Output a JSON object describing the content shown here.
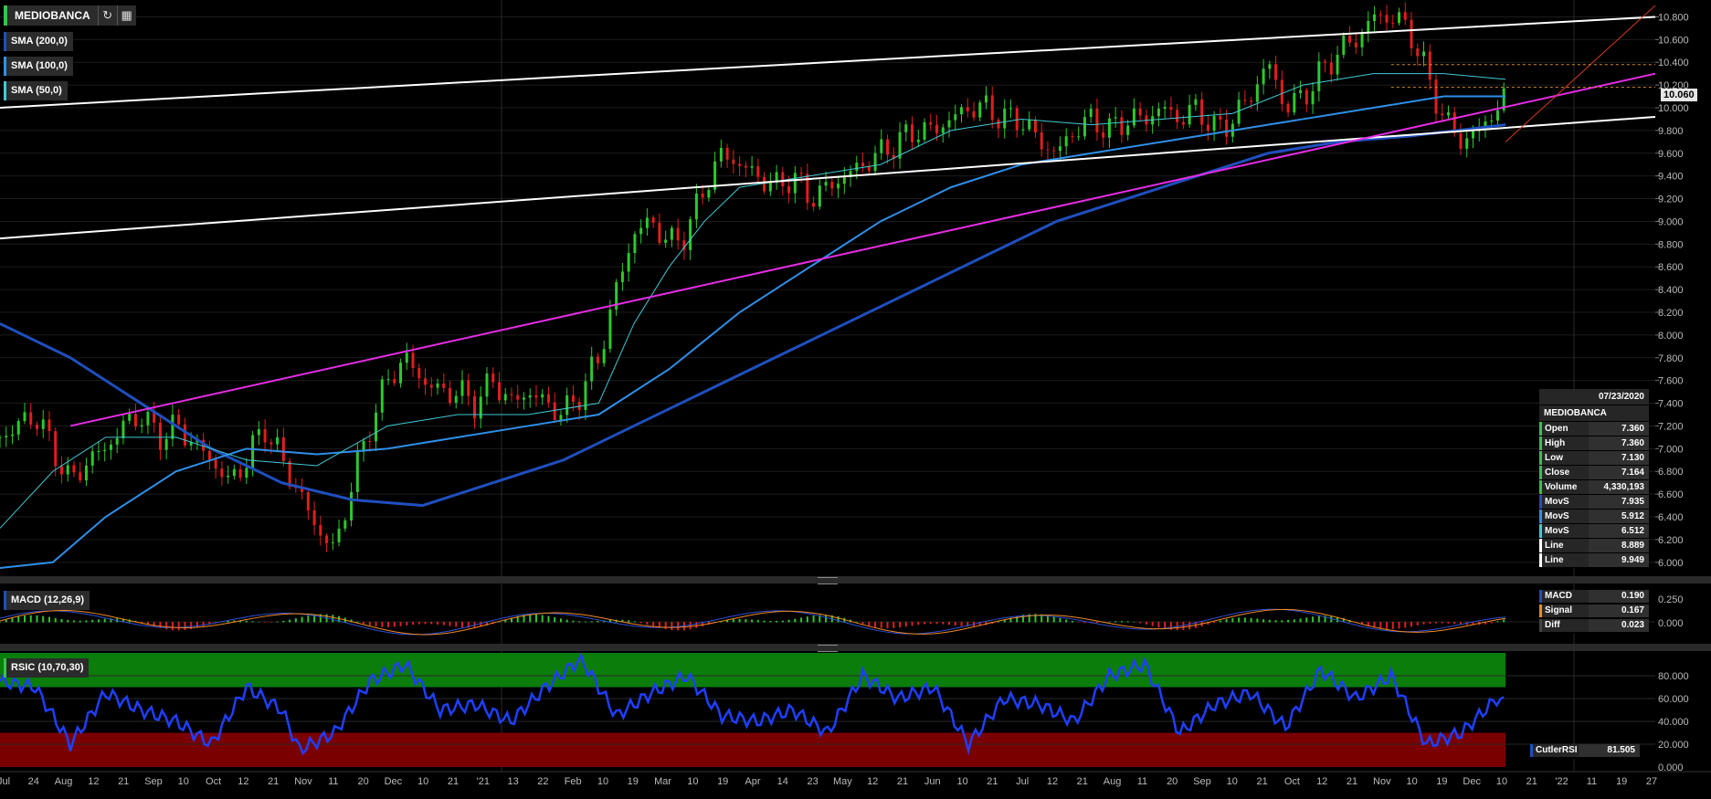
{
  "header": {
    "symbol": "MEDIOBANCA",
    "refresh_icon": "refresh-icon",
    "settings_icon": "chart-settings-icon"
  },
  "indicators": [
    {
      "label": "SMA (200,0)",
      "color": "#1f4fbf"
    },
    {
      "label": "SMA (100,0)",
      "color": "#2f8fe8"
    },
    {
      "label": "SMA (50,0)",
      "color": "#41c9d6"
    }
  ],
  "info_panel": {
    "date": "07/23/2020",
    "symbol": "MEDIOBANCA",
    "rows": [
      {
        "k": "Open",
        "v": "7.360",
        "c": "#39c24a"
      },
      {
        "k": "High",
        "v": "7.360",
        "c": "#39c24a"
      },
      {
        "k": "Low",
        "v": "7.130",
        "c": "#39c24a"
      },
      {
        "k": "Close",
        "v": "7.164",
        "c": "#39c24a"
      },
      {
        "k": "Volume",
        "v": "4,330,193",
        "c": "#39c24a"
      },
      {
        "k": "MovS",
        "v": "7.935",
        "c": "#1f4fbf"
      },
      {
        "k": "MovS",
        "v": "5.912",
        "c": "#2f8fe8"
      },
      {
        "k": "MovS",
        "v": "6.512",
        "c": "#41c9d6"
      },
      {
        "k": "Line",
        "v": "8.889",
        "c": "#ffffff"
      },
      {
        "k": "Line",
        "v": "9.949",
        "c": "#ffffff"
      }
    ]
  },
  "macd": {
    "label": "MACD (12,26,9)",
    "rows": [
      {
        "k": "MACD",
        "v": "0.190",
        "c": "#1f4fbf"
      },
      {
        "k": "Signal",
        "v": "0.167",
        "c": "#f08a24"
      },
      {
        "k": "Diff",
        "v": "0.023",
        "c": "#444444"
      }
    ],
    "ticks": [
      "0.250",
      "0.000"
    ]
  },
  "rsi": {
    "label": "RSIC (10,70,30)",
    "rows": [
      {
        "k": "CutlerRSI",
        "v": "81.505",
        "c": "#1f4fbf"
      }
    ],
    "ticks": [
      "80.000",
      "60.000",
      "40.000",
      "20.000",
      "0.000"
    ]
  },
  "current_price": "10.060",
  "chart_data": {
    "type": "candlestick",
    "symbol": "MEDIOBANCA",
    "y_ticks": [
      "10.800",
      "10.600",
      "10.400",
      "10.200",
      "10.000",
      "9.800",
      "9.600",
      "9.400",
      "9.200",
      "9.000",
      "8.800",
      "8.600",
      "8.400",
      "8.200",
      "8.000",
      "7.800",
      "7.600",
      "7.400",
      "7.200",
      "7.000",
      "6.800",
      "6.600",
      "6.400",
      "6.200",
      "6.000"
    ],
    "ylim": [
      5.95,
      10.9
    ],
    "x_tick_labels": [
      "Jul",
      "24",
      "Aug",
      "12",
      "21",
      "Sep",
      "10",
      "Oct",
      "12",
      "21",
      "Nov",
      "11",
      "20",
      "Dec",
      "10",
      "21",
      "'21",
      "13",
      "22",
      "Feb",
      "10",
      "19",
      "Mar",
      "10",
      "19",
      "Apr",
      "14",
      "23",
      "May",
      "12",
      "21",
      "Jun",
      "10",
      "21",
      "Jul",
      "12",
      "21",
      "Aug",
      "11",
      "20",
      "Sep",
      "10",
      "21",
      "Oct",
      "12",
      "21",
      "Nov",
      "10",
      "19",
      "Dec",
      "10",
      "21",
      "'22",
      "11",
      "19",
      "27"
    ],
    "approx_close_path": [
      [
        0,
        7.1
      ],
      [
        10,
        7.2
      ],
      [
        20,
        7.3
      ],
      [
        30,
        7.0
      ],
      [
        40,
        6.7
      ],
      [
        50,
        6.9
      ],
      [
        60,
        7.0
      ],
      [
        70,
        7.2
      ],
      [
        80,
        7.3
      ],
      [
        90,
        7.1
      ],
      [
        100,
        7.2
      ],
      [
        110,
        7.05
      ],
      [
        120,
        6.9
      ],
      [
        130,
        6.7
      ],
      [
        140,
        6.9
      ],
      [
        150,
        7.2
      ],
      [
        160,
        6.9
      ],
      [
        170,
        6.6
      ],
      [
        180,
        6.3
      ],
      [
        190,
        6.1
      ],
      [
        200,
        6.7
      ],
      [
        210,
        7.2
      ],
      [
        220,
        7.6
      ],
      [
        230,
        7.8
      ],
      [
        240,
        7.6
      ],
      [
        250,
        7.5
      ],
      [
        260,
        7.5
      ],
      [
        270,
        7.4
      ],
      [
        280,
        7.6
      ],
      [
        290,
        7.4
      ],
      [
        300,
        7.5
      ],
      [
        310,
        7.4
      ],
      [
        320,
        7.3
      ],
      [
        330,
        7.5
      ],
      [
        340,
        7.8
      ],
      [
        350,
        8.4
      ],
      [
        360,
        8.9
      ],
      [
        370,
        9.0
      ],
      [
        380,
        8.8
      ],
      [
        390,
        8.9
      ],
      [
        400,
        9.3
      ],
      [
        410,
        9.6
      ],
      [
        420,
        9.5
      ],
      [
        430,
        9.4
      ],
      [
        440,
        9.3
      ],
      [
        450,
        9.4
      ],
      [
        460,
        9.2
      ],
      [
        470,
        9.3
      ],
      [
        480,
        9.4
      ],
      [
        490,
        9.5
      ],
      [
        500,
        9.6
      ],
      [
        510,
        9.7
      ],
      [
        520,
        9.8
      ],
      [
        530,
        9.8
      ],
      [
        540,
        9.9
      ],
      [
        550,
        10.0
      ],
      [
        560,
        10.0
      ],
      [
        570,
        9.9
      ],
      [
        580,
        9.9
      ],
      [
        590,
        9.7
      ],
      [
        600,
        9.6
      ],
      [
        610,
        9.8
      ],
      [
        620,
        9.9
      ],
      [
        630,
        9.8
      ],
      [
        640,
        9.9
      ],
      [
        650,
        9.9
      ],
      [
        660,
        10.0
      ],
      [
        670,
        9.9
      ],
      [
        680,
        10.0
      ],
      [
        690,
        9.8
      ],
      [
        700,
        9.9
      ],
      [
        710,
        10.1
      ],
      [
        720,
        10.4
      ],
      [
        730,
        10.0
      ],
      [
        740,
        10.1
      ],
      [
        750,
        10.3
      ],
      [
        760,
        10.5
      ],
      [
        770,
        10.6
      ],
      [
        780,
        10.8
      ],
      [
        790,
        10.8
      ],
      [
        800,
        10.7
      ],
      [
        810,
        10.3
      ],
      [
        820,
        9.9
      ],
      [
        830,
        9.7
      ],
      [
        840,
        9.8
      ],
      [
        850,
        10.0
      ],
      [
        855,
        10.1
      ]
    ],
    "sma200_path": [
      [
        0,
        8.1
      ],
      [
        40,
        7.8
      ],
      [
        80,
        7.4
      ],
      [
        120,
        7.0
      ],
      [
        160,
        6.7
      ],
      [
        200,
        6.55
      ],
      [
        240,
        6.5
      ],
      [
        280,
        6.7
      ],
      [
        320,
        6.9
      ],
      [
        360,
        7.2
      ],
      [
        400,
        7.5
      ],
      [
        440,
        7.8
      ],
      [
        480,
        8.1
      ],
      [
        520,
        8.4
      ],
      [
        560,
        8.7
      ],
      [
        600,
        9.0
      ],
      [
        640,
        9.2
      ],
      [
        680,
        9.4
      ],
      [
        720,
        9.6
      ],
      [
        760,
        9.7
      ],
      [
        800,
        9.75
      ],
      [
        855,
        9.85
      ]
    ],
    "sma100_path": [
      [
        0,
        5.95
      ],
      [
        30,
        6.0
      ],
      [
        60,
        6.4
      ],
      [
        100,
        6.8
      ],
      [
        140,
        7.0
      ],
      [
        180,
        6.95
      ],
      [
        220,
        7.0
      ],
      [
        260,
        7.1
      ],
      [
        300,
        7.2
      ],
      [
        340,
        7.3
      ],
      [
        380,
        7.7
      ],
      [
        420,
        8.2
      ],
      [
        460,
        8.6
      ],
      [
        500,
        9.0
      ],
      [
        540,
        9.3
      ],
      [
        580,
        9.5
      ],
      [
        620,
        9.6
      ],
      [
        660,
        9.7
      ],
      [
        700,
        9.8
      ],
      [
        740,
        9.9
      ],
      [
        780,
        10.0
      ],
      [
        820,
        10.1
      ],
      [
        855,
        10.1
      ]
    ],
    "sma50_path": [
      [
        0,
        6.3
      ],
      [
        30,
        6.8
      ],
      [
        60,
        7.1
      ],
      [
        100,
        7.1
      ],
      [
        140,
        6.9
      ],
      [
        180,
        6.85
      ],
      [
        220,
        7.2
      ],
      [
        260,
        7.3
      ],
      [
        300,
        7.3
      ],
      [
        340,
        7.4
      ],
      [
        360,
        8.1
      ],
      [
        380,
        8.6
      ],
      [
        400,
        9.0
      ],
      [
        420,
        9.3
      ],
      [
        460,
        9.4
      ],
      [
        500,
        9.5
      ],
      [
        540,
        9.8
      ],
      [
        580,
        9.9
      ],
      [
        620,
        9.85
      ],
      [
        660,
        9.9
      ],
      [
        700,
        9.95
      ],
      [
        740,
        10.2
      ],
      [
        780,
        10.3
      ],
      [
        820,
        10.3
      ],
      [
        855,
        10.25
      ]
    ],
    "trend_lines": [
      {
        "color": "#ffffff",
        "from": [
          0,
          10.0
        ],
        "to": [
          940,
          10.8
        ]
      },
      {
        "color": "#ffffff",
        "from": [
          0,
          8.85
        ],
        "to": [
          940,
          9.92
        ]
      },
      {
        "color": "#e62ce6",
        "from": [
          40,
          7.2
        ],
        "to": [
          940,
          10.3
        ]
      },
      {
        "color": "#d23a1e",
        "from": [
          855,
          9.7
        ],
        "to": [
          940,
          10.9
        ]
      }
    ],
    "dashed_levels": [
      10.38,
      10.18
    ],
    "rsi_path": [
      [
        0,
        75
      ],
      [
        20,
        70
      ],
      [
        40,
        20
      ],
      [
        60,
        65
      ],
      [
        80,
        50
      ],
      [
        100,
        40
      ],
      [
        120,
        20
      ],
      [
        140,
        70
      ],
      [
        160,
        50
      ],
      [
        170,
        15
      ],
      [
        190,
        30
      ],
      [
        210,
        75
      ],
      [
        230,
        90
      ],
      [
        250,
        50
      ],
      [
        270,
        55
      ],
      [
        290,
        40
      ],
      [
        310,
        70
      ],
      [
        330,
        95
      ],
      [
        350,
        45
      ],
      [
        370,
        65
      ],
      [
        390,
        80
      ],
      [
        410,
        45
      ],
      [
        430,
        40
      ],
      [
        450,
        50
      ],
      [
        470,
        30
      ],
      [
        490,
        80
      ],
      [
        510,
        60
      ],
      [
        530,
        70
      ],
      [
        550,
        20
      ],
      [
        570,
        60
      ],
      [
        590,
        55
      ],
      [
        610,
        40
      ],
      [
        630,
        80
      ],
      [
        650,
        90
      ],
      [
        670,
        30
      ],
      [
        690,
        55
      ],
      [
        710,
        65
      ],
      [
        730,
        35
      ],
      [
        750,
        85
      ],
      [
        770,
        60
      ],
      [
        790,
        80
      ],
      [
        810,
        20
      ],
      [
        830,
        30
      ],
      [
        850,
        60
      ],
      [
        855,
        55
      ]
    ]
  }
}
